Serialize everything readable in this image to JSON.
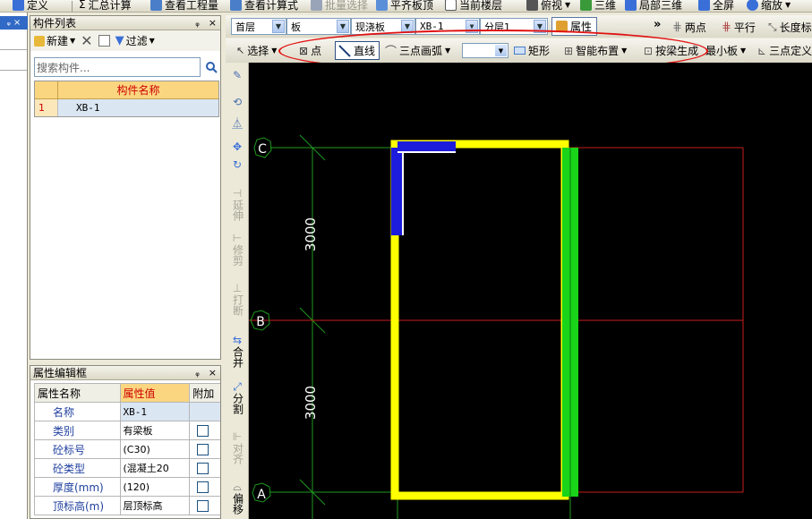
{
  "top_toolbar": {
    "items": [
      {
        "label": "定义",
        "icon": "define-icon",
        "color": "#3a6fd8"
      },
      {
        "label": "汇总计算",
        "icon": "sum-icon",
        "glyph": "Σ"
      },
      {
        "label": "查看工程量",
        "icon": "view-quantity-icon",
        "color": "#4a7ec8"
      },
      {
        "label": "查看计算式",
        "icon": "view-formula-icon",
        "color": "#4a7ec8"
      },
      {
        "label": "批量选择",
        "icon": "batch-select-icon",
        "color": "#9aa4b8"
      },
      {
        "label": "平齐板顶",
        "icon": "flush-top-icon",
        "color": "#5b8fd8"
      },
      {
        "label": "当前楼层",
        "icon": "current-floor-icon"
      },
      {
        "label": "俯视",
        "icon": "top-view-icon",
        "color": "#555"
      },
      {
        "label": "三维",
        "icon": "3d-icon",
        "color": "#3a9a3a"
      },
      {
        "label": "局部三维",
        "icon": "local-3d-icon",
        "color": "#3a6fd8"
      },
      {
        "label": "全屏",
        "icon": "fullscreen-icon",
        "color": "#3a6fd8"
      },
      {
        "label": "缩放",
        "icon": "zoom-icon",
        "color": "#3a6fd8"
      }
    ]
  },
  "left_strip": {
    "pin": "ᵩ",
    "close": "×"
  },
  "component_panel": {
    "title": "构件列表",
    "pin": "ᵩ",
    "close": "×",
    "new_label": "新建",
    "filter_label": "过滤",
    "search_placeholder": "搜索构件...",
    "column_header": "构件名称",
    "rows": [
      {
        "index": "1",
        "name": "XB-1"
      }
    ]
  },
  "property_panel": {
    "title": "属性编辑框",
    "pin": "ᵩ",
    "close": "×",
    "headers": {
      "name": "属性名称",
      "value": "属性值",
      "extra": "附加"
    },
    "rows": [
      {
        "name": "名称",
        "value": "XB-1",
        "has_check": false
      },
      {
        "name": "类别",
        "value": "有梁板",
        "has_check": true
      },
      {
        "name": "砼标号",
        "value": "(C30)",
        "has_check": true
      },
      {
        "name": "砼类型",
        "value": "(混凝土20",
        "has_check": true
      },
      {
        "name": "厚度(mm)",
        "value": "(120)",
        "has_check": true
      },
      {
        "name": "顶标高(m)",
        "value": "层顶标高",
        "has_check": true
      }
    ]
  },
  "selector_bar": {
    "floor": "首层",
    "type": "板",
    "subtype": "现浇板",
    "component": "XB-1",
    "layer": "分层1",
    "attr_label": "属性",
    "more": "»",
    "two_point": "两点",
    "parallel": "平行",
    "length_label": "长度标"
  },
  "draw_bar": {
    "select": "选择",
    "point": "点",
    "line": "直线",
    "arc": "三点画弧",
    "rect": "矩形",
    "smart": "智能布置",
    "by_beam": "按梁生成",
    "min_board": "最小板",
    "three_point_def": "三点定义"
  },
  "vertical_tools": {
    "extend": "延伸",
    "trim": "修剪",
    "break": "打断",
    "merge": "合并",
    "split": "分割",
    "align": "对齐",
    "offset": "偏移"
  },
  "drawing": {
    "axes": [
      "C",
      "B",
      "A"
    ],
    "dimensions": [
      "3000",
      "3000"
    ],
    "colors": {
      "background": "#000000",
      "grid_green": "#1f9a1f",
      "grid_red": "#c81e1e",
      "slab_yellow": "#ffff00",
      "slab_blue": "#1c1cdc",
      "slab_green": "#19d419",
      "oval_red": "#e01010"
    }
  }
}
